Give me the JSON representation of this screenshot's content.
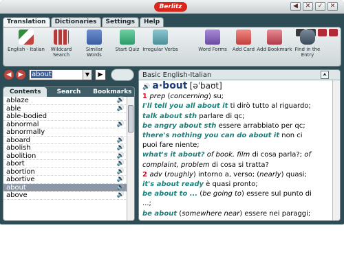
{
  "brand": "Berlitz",
  "window_buttons": [
    "◀",
    "✕",
    "✓",
    "✕"
  ],
  "tabs": [
    {
      "label": "Translation",
      "active": true
    },
    {
      "label": "Dictionaries",
      "active": false
    },
    {
      "label": "Settings",
      "active": false
    },
    {
      "label": "Help",
      "active": false
    }
  ],
  "toolbar": {
    "items": [
      {
        "label": "English - Italian",
        "icon": "flags-icon",
        "color": "#2f8f3a"
      },
      {
        "label": "Wildcard Search",
        "icon": "wildcard-grid-icon",
        "color": "#b53a3a"
      },
      {
        "label": "Similar Words",
        "icon": "similar-words-icon",
        "color": "#4a6fb0"
      },
      {
        "label": "Start Quiz",
        "icon": "quiz-checkmark-icon",
        "color": "#2d9a6a"
      },
      {
        "label": "Irregular Verbs",
        "icon": "verbs-icon",
        "color": "#4b8f9a"
      },
      {
        "label": "Word Forms",
        "icon": "word-forms-icon",
        "color": "#6b4aa0"
      },
      {
        "label": "Add Card",
        "icon": "add-card-icon",
        "color": "#c2403a"
      },
      {
        "label": "Add Bookmark",
        "icon": "add-bookmark-icon",
        "color": "#b03b48"
      },
      {
        "label": "Find in the Entry",
        "icon": "binoculars-icon",
        "color": "#3a4a5a"
      }
    ]
  },
  "search": {
    "value": "about",
    "dropdown_glyph": "▼",
    "go_glyph": "▶"
  },
  "left_tabs": [
    {
      "label": "Contents",
      "active": true
    },
    {
      "label": "Search",
      "active": false
    },
    {
      "label": "Bookmarks",
      "active": false
    }
  ],
  "words": [
    {
      "text": "ablaze",
      "audio": true
    },
    {
      "text": "able",
      "audio": true
    },
    {
      "text": "able-bodied",
      "audio": false
    },
    {
      "text": "abnormal",
      "audio": true
    },
    {
      "text": "abnormally",
      "audio": false
    },
    {
      "text": "aboard",
      "audio": true
    },
    {
      "text": "abolish",
      "audio": true
    },
    {
      "text": "abolition",
      "audio": true
    },
    {
      "text": "abort",
      "audio": true
    },
    {
      "text": "abortion",
      "audio": true
    },
    {
      "text": "abortive",
      "audio": true
    },
    {
      "text": "about",
      "audio": true,
      "selected": true
    },
    {
      "text": "above",
      "audio": true
    }
  ],
  "dictionary_title": "Basic English-Italian",
  "entry": {
    "headword": "a·bout",
    "pronunciation": "[əˈbaʊt]",
    "lines": [
      [
        {
          "t": "1 ",
          "c": "num"
        },
        {
          "t": "prep ",
          "c": "it"
        },
        {
          "t": "(",
          "c": ""
        },
        {
          "t": "concerning",
          "c": "it"
        },
        {
          "t": ") su;",
          "c": ""
        }
      ],
      [
        {
          "t": "I'll tell you all about it",
          "c": "ex"
        },
        {
          "t": " ti dirò tutto al riguardo;",
          "c": ""
        }
      ],
      [
        {
          "t": "talk about sth",
          "c": "ex"
        },
        {
          "t": " parlare di qc;",
          "c": ""
        }
      ],
      [
        {
          "t": "be angry about sth",
          "c": "ex"
        },
        {
          "t": " essere arrabbiato per qc;",
          "c": ""
        }
      ],
      [
        {
          "t": "there's nothing you can do about it",
          "c": "ex"
        },
        {
          "t": " non ci",
          "c": ""
        }
      ],
      [
        {
          "t": "puoi fare niente;",
          "c": ""
        }
      ],
      [
        {
          "t": "what's it about?",
          "c": "ex"
        },
        {
          "t": " ",
          "c": ""
        },
        {
          "t": "of book, film",
          "c": "it"
        },
        {
          "t": " di cosa parla?; ",
          "c": ""
        },
        {
          "t": "of",
          "c": "it"
        }
      ],
      [
        {
          "t": "complaint, problem",
          "c": "it"
        },
        {
          "t": " di cosa si tratta?",
          "c": ""
        }
      ],
      [
        {
          "t": "2 ",
          "c": "num"
        },
        {
          "t": "adv ",
          "c": "it"
        },
        {
          "t": "(",
          "c": ""
        },
        {
          "t": "roughly",
          "c": "it"
        },
        {
          "t": ") intorno a, verso; (",
          "c": ""
        },
        {
          "t": "nearly",
          "c": "it"
        },
        {
          "t": ") quasi;",
          "c": ""
        }
      ],
      [
        {
          "t": "it's about ready",
          "c": "ex"
        },
        {
          "t": " è quasi pronto;",
          "c": ""
        }
      ],
      [
        {
          "t": "be about to ...",
          "c": "ex"
        },
        {
          "t": " (",
          "c": ""
        },
        {
          "t": "be going to",
          "c": "it"
        },
        {
          "t": ") essere sul punto di",
          "c": ""
        }
      ],
      [
        {
          "t": "...;",
          "c": ""
        }
      ],
      [
        {
          "t": "be about",
          "c": "ex"
        },
        {
          "t": " (",
          "c": ""
        },
        {
          "t": "somewhere near",
          "c": "it"
        },
        {
          "t": ") essere nei paraggi;",
          "c": ""
        }
      ]
    ]
  },
  "colors": {
    "frame": "#2e4c56",
    "headword": "#1d3c78",
    "example": "#1a8079",
    "sense_number": "#c0122b",
    "selection": "#8b97a6"
  }
}
